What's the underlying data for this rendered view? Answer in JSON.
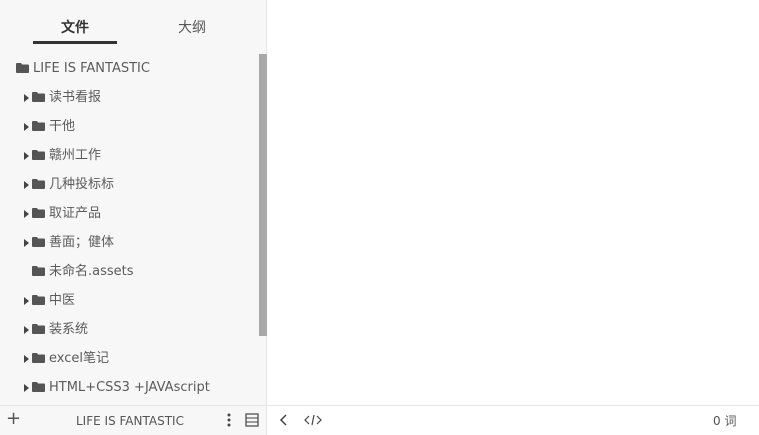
{
  "sidebar": {
    "tabs": [
      {
        "label": "文件"
      },
      {
        "label": "大纲"
      }
    ],
    "root": {
      "label": "LIFE IS FANTASTIC",
      "icon": "folder-icon"
    },
    "items": [
      {
        "label": "读书看报",
        "expandable": true,
        "icon": "folder-icon"
      },
      {
        "label": "干他",
        "expandable": true,
        "icon": "folder-icon"
      },
      {
        "label": "赣州工作",
        "expandable": true,
        "icon": "folder-icon"
      },
      {
        "label": "几种投标标",
        "expandable": true,
        "icon": "folder-icon"
      },
      {
        "label": "取证产品",
        "expandable": true,
        "icon": "folder-icon"
      },
      {
        "label": "善面；健体",
        "expandable": true,
        "icon": "folder-icon"
      },
      {
        "label": "未命名.assets",
        "expandable": false,
        "icon": "folder-icon"
      },
      {
        "label": "中医",
        "expandable": true,
        "icon": "folder-icon"
      },
      {
        "label": "装系统",
        "expandable": true,
        "icon": "folder-icon"
      },
      {
        "label": "excel笔记",
        "expandable": true,
        "icon": "folder-icon"
      },
      {
        "label": "HTML+CSS3 +JAVAscript",
        "expandable": true,
        "icon": "folder-icon"
      }
    ]
  },
  "footer": {
    "add_label": "+",
    "folder_title": "LIFE IS FANTASTIC",
    "more_icon": "more-vertical-icon",
    "layout_icon": "layout-icon",
    "back_icon": "chevron-left-icon",
    "source_icon": "source-code-icon",
    "word_count": "0 词"
  },
  "colors": {
    "sidebar_bg": "#f7f7f7",
    "folder": "#555555",
    "scrollbar": "#a8a8a8",
    "text": "#5b5b5b"
  }
}
